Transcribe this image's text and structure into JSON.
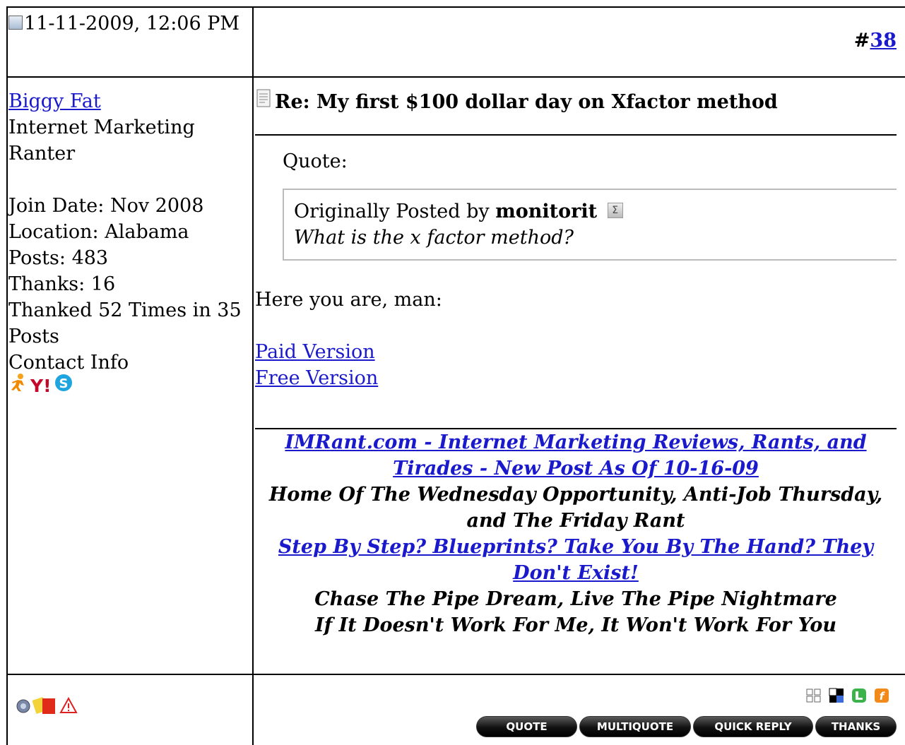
{
  "post": {
    "date": "11-11-2009, 12:06 PM",
    "number_prefix": "#",
    "number": "38"
  },
  "user": {
    "name": "Biggy Fat",
    "title": "Internet Marketing Ranter",
    "join_date": "Join Date: Nov 2008",
    "location": "Location: Alabama",
    "posts": "Posts: 483",
    "thanks": "Thanks: 16",
    "thanked": "Thanked 52 Times in 35 Posts",
    "contact": "Contact Info",
    "contact_icons": [
      "aim-icon",
      "yahoo-icon",
      "skype-icon"
    ]
  },
  "message": {
    "title": "Re: My first $100 dollar day on Xfactor method",
    "quote_label": "Quote:",
    "quote_prefix": "Originally Posted by",
    "quote_author": "monitorit",
    "quote_text": "What is the x factor method?",
    "body": "Here you are, man:",
    "links": [
      "Paid Version",
      "Free Version"
    ]
  },
  "signature": {
    "link1": "IMRant.com - Internet Marketing Reviews, Rants, and Tirades - New Post As Of 10-16-09",
    "line2": "Home Of The Wednesday Opportunity, Anti-Job Thursday, and The Friday Rant",
    "link3": "Step By Step? Blueprints? Take You By The Hand? They Don't Exist!",
    "line4": "Chase The Pipe Dream, Live The Pipe Nightmare",
    "line5": "If It Doesn't Work For Me, It Won't Work For You"
  },
  "footer": {
    "left_icons": [
      "user-offline-icon",
      "infraction-card-icon",
      "report-post-icon"
    ],
    "share_icons": [
      "digg-icon",
      "delicious-icon",
      "technorati-icon",
      "facebook-icon"
    ],
    "buttons": {
      "quote": "QUOTE",
      "multiquote": "MULTIQUOTE",
      "quick_reply": "QUICK REPLY",
      "thanks": "THANKS"
    }
  }
}
